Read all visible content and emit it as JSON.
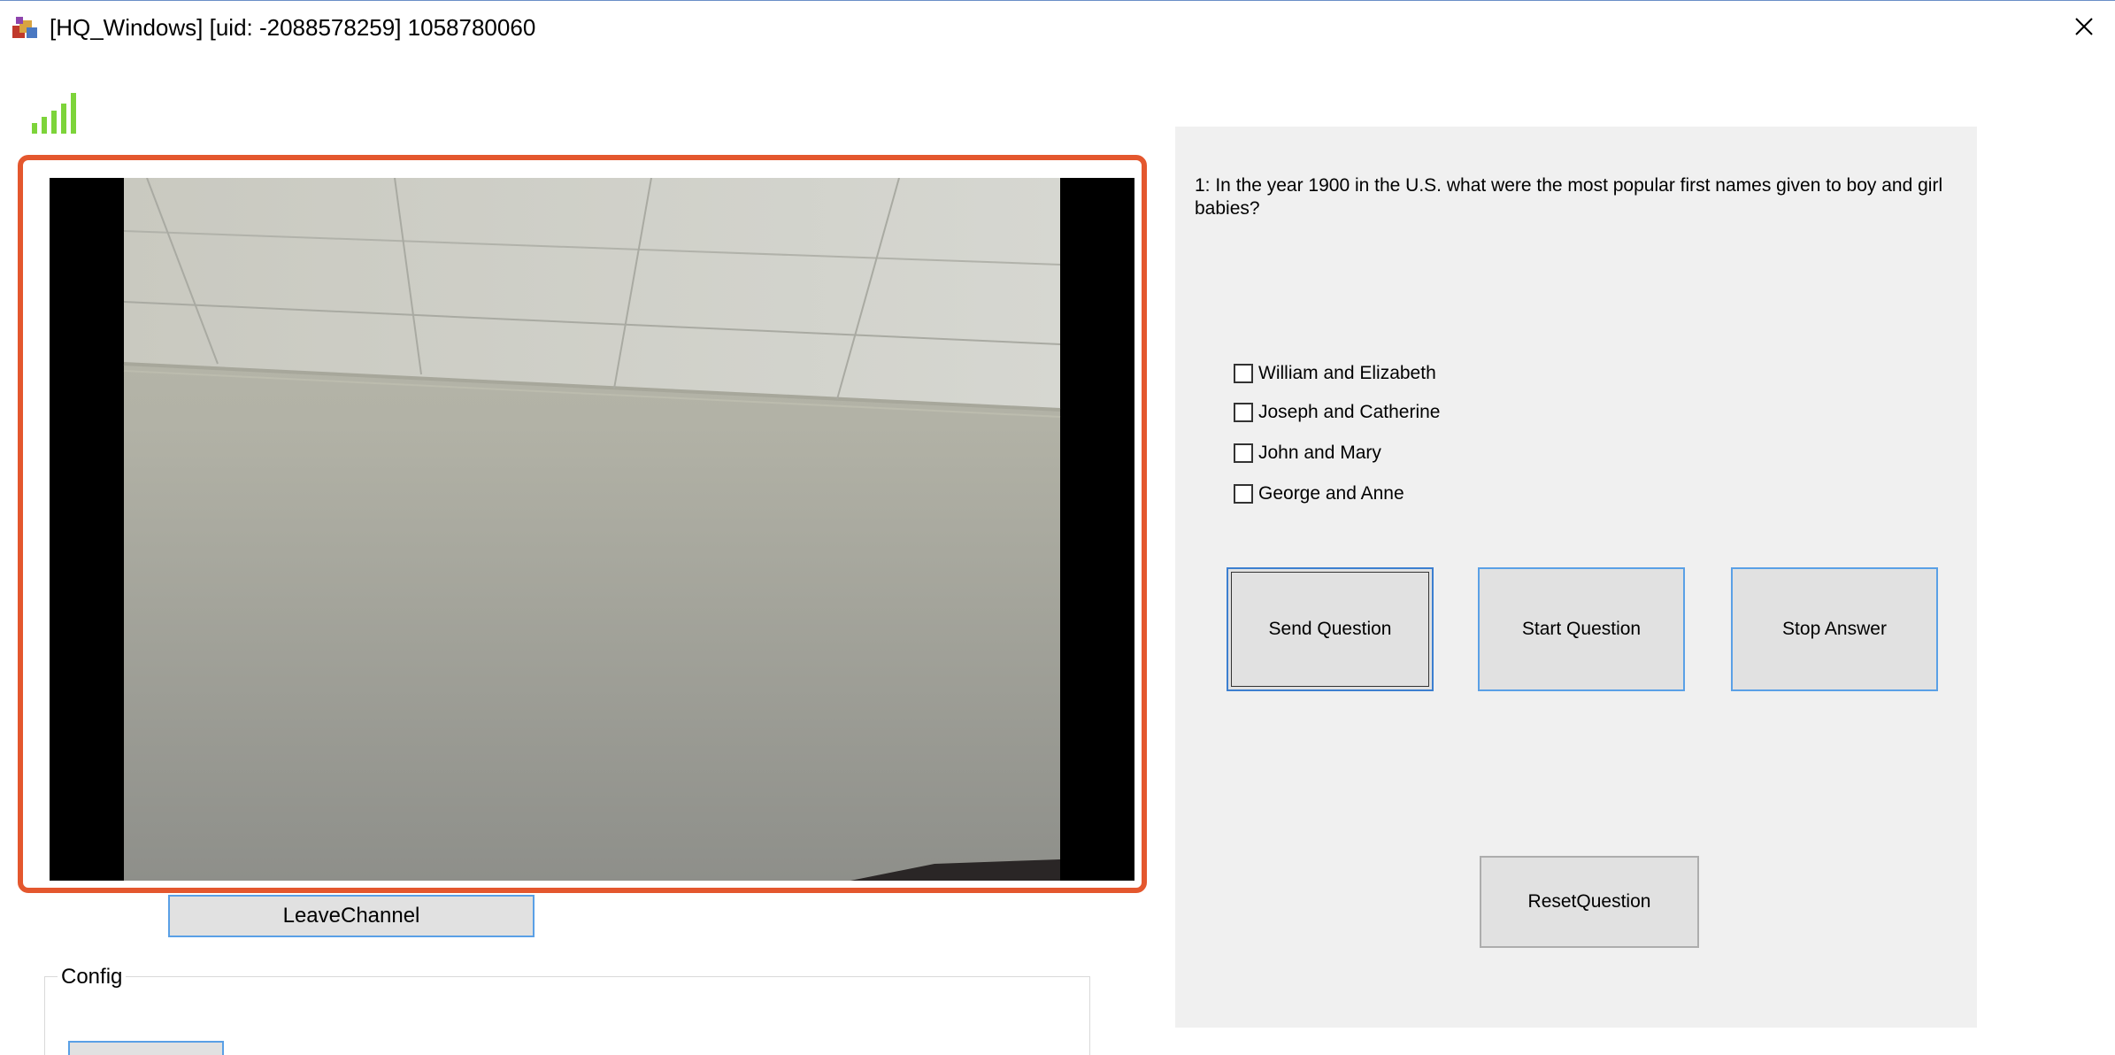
{
  "window": {
    "title": "[HQ_Windows] [uid: -2088578259] 1058780060",
    "close_icon": "close-icon",
    "app_icon": "app-icon"
  },
  "status": {
    "signal_icon": "signal-strength-icon",
    "signal_level": 5,
    "signal_color": "#7dd43a"
  },
  "video": {
    "frame_color": "#e4572e",
    "leave_label": "LeaveChannel"
  },
  "config": {
    "legend": "Config"
  },
  "question_panel": {
    "question": "1: In the year 1900 in the U.S. what were the most popular first names given to boy and girl babies?",
    "options": [
      {
        "label": "William and Elizabeth",
        "checked": false
      },
      {
        "label": "Joseph and Catherine",
        "checked": false
      },
      {
        "label": "John and Mary",
        "checked": false
      },
      {
        "label": "George and Anne",
        "checked": false
      }
    ],
    "buttons": {
      "send": "Send Question",
      "start": "Start Question",
      "stop": "Stop Answer",
      "reset": "ResetQuestion"
    }
  }
}
